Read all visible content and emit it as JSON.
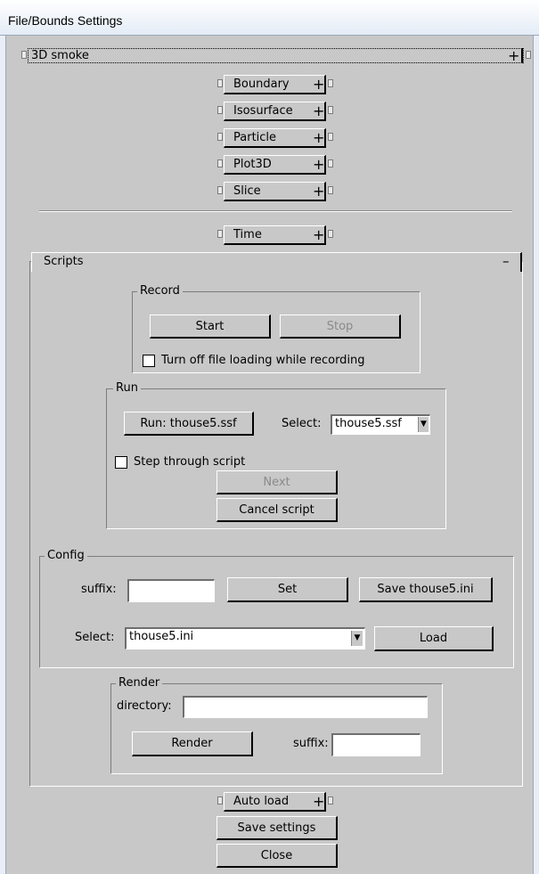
{
  "window": {
    "title": "File/Bounds Settings"
  },
  "smoke3d": {
    "label": "3D smoke",
    "toggle": "+"
  },
  "rollouts": [
    {
      "label": "Boundary",
      "toggle": "+"
    },
    {
      "label": "Isosurface",
      "toggle": "+"
    },
    {
      "label": "Particle",
      "toggle": "+"
    },
    {
      "label": "Plot3D",
      "toggle": "+"
    },
    {
      "label": "Slice",
      "toggle": "+"
    },
    {
      "label": "Time",
      "toggle": "+"
    }
  ],
  "scripts": {
    "label": "Scripts",
    "toggle": "–",
    "record": {
      "label": "Record",
      "start": "Start",
      "stop": "Stop",
      "turn_off_loading": "Turn off file loading while recording"
    },
    "run": {
      "label": "Run",
      "run_button": "Run: thouse5.ssf",
      "select_label": "Select:",
      "select_value": "thouse5.ssf",
      "step_through": "Step through script",
      "next": "Next",
      "cancel": "Cancel script"
    },
    "config": {
      "label": "Config",
      "suffix_label": "suffix:",
      "suffix_value": "",
      "set": "Set",
      "save": "Save thouse5.ini",
      "select_label": "Select:",
      "select_value": "thouse5.ini",
      "load": "Load"
    },
    "render": {
      "label": "Render",
      "directory_label": "directory:",
      "directory_value": "",
      "render_button": "Render",
      "suffix_label": "suffix:",
      "suffix_value": ""
    }
  },
  "footer": {
    "auto_load": "Auto load",
    "auto_load_toggle": "+",
    "save_settings": "Save settings",
    "close": "Close"
  }
}
